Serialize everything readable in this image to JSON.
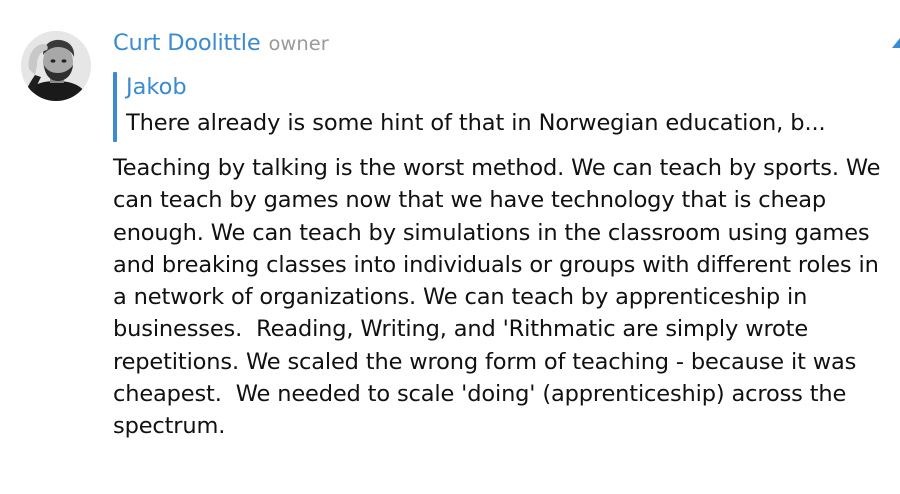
{
  "message": {
    "sender": {
      "name": "Curt Doolittle",
      "role": "owner",
      "avatar_icon": "user-photo-avatar"
    },
    "reply_to": {
      "author": "Jakob",
      "excerpt": "There already is some hint of that in Norwegian education, b..."
    },
    "text": "Teaching by talking is the worst method. We can teach by sports. We can teach by games now that we have technology that is cheap enough. We can teach by simulations in the classroom using games and breaking classes into individuals or groups with different roles in a network of organizations. We can teach by apprenticeship in businesses.  Reading, Writing, and 'Rithmatic are simply wrote repetitions. We scaled the wrong form of teaching - because it was cheapest.  We needed to scale 'doing' (apprenticeship) across the spectrum."
  },
  "colors": {
    "accent": "#3a8bd0",
    "role_text": "#9a9a9a",
    "body_text": "#111111",
    "background": "#ffffff"
  }
}
